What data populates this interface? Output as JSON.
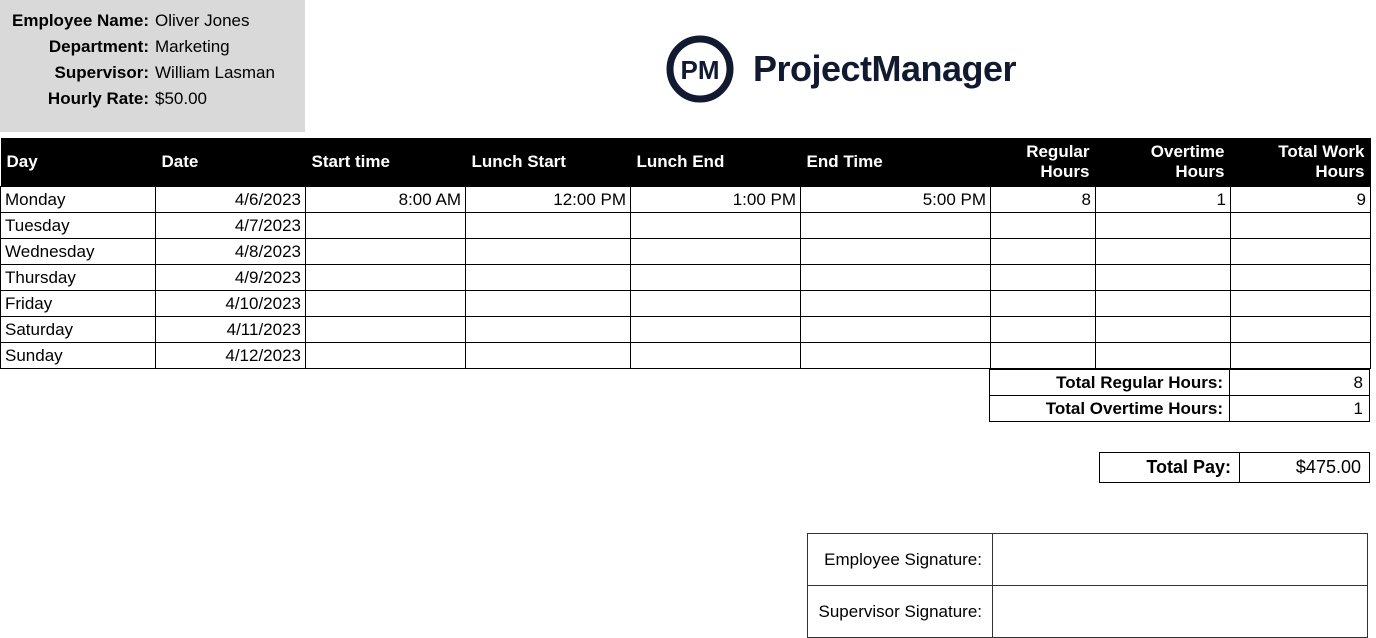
{
  "employee": {
    "name_label": "Employee Name:",
    "name_value": "Oliver Jones",
    "department_label": "Department:",
    "department_value": "Marketing",
    "supervisor_label": "Supervisor:",
    "supervisor_value": "William Lasman",
    "rate_label": "Hourly Rate:",
    "rate_value": "$50.00"
  },
  "brand": {
    "name": "ProjectManager",
    "logo_text": "PM"
  },
  "headers": {
    "day": "Day",
    "date": "Date",
    "start": "Start time",
    "lunch_start": "Lunch Start",
    "lunch_end": "Lunch End",
    "end": "End Time",
    "regular": "Regular Hours",
    "overtime": "Overtime Hours",
    "total": "Total Work Hours"
  },
  "rows": [
    {
      "day": "Monday",
      "date": "4/6/2023",
      "start": "8:00 AM",
      "lunch_start": "12:00 PM",
      "lunch_end": "1:00 PM",
      "end": "5:00 PM",
      "regular": "8",
      "overtime": "1",
      "total": "9"
    },
    {
      "day": "Tuesday",
      "date": "4/7/2023",
      "start": "",
      "lunch_start": "",
      "lunch_end": "",
      "end": "",
      "regular": "",
      "overtime": "",
      "total": ""
    },
    {
      "day": "Wednesday",
      "date": "4/8/2023",
      "start": "",
      "lunch_start": "",
      "lunch_end": "",
      "end": "",
      "regular": "",
      "overtime": "",
      "total": ""
    },
    {
      "day": "Thursday",
      "date": "4/9/2023",
      "start": "",
      "lunch_start": "",
      "lunch_end": "",
      "end": "",
      "regular": "",
      "overtime": "",
      "total": ""
    },
    {
      "day": "Friday",
      "date": "4/10/2023",
      "start": "",
      "lunch_start": "",
      "lunch_end": "",
      "end": "",
      "regular": "",
      "overtime": "",
      "total": ""
    },
    {
      "day": "Saturday",
      "date": "4/11/2023",
      "start": "",
      "lunch_start": "",
      "lunch_end": "",
      "end": "",
      "regular": "",
      "overtime": "",
      "total": ""
    },
    {
      "day": "Sunday",
      "date": "4/12/2023",
      "start": "",
      "lunch_start": "",
      "lunch_end": "",
      "end": "",
      "regular": "",
      "overtime": "",
      "total": ""
    }
  ],
  "totals": {
    "regular_label": "Total Regular Hours:",
    "regular_value": "8",
    "overtime_label": "Total Overtime Hours:",
    "overtime_value": "1",
    "pay_label": "Total Pay:",
    "pay_value": "$475.00"
  },
  "signatures": {
    "employee_label": "Employee Signature:",
    "supervisor_label": "Supervisor Signature:"
  }
}
